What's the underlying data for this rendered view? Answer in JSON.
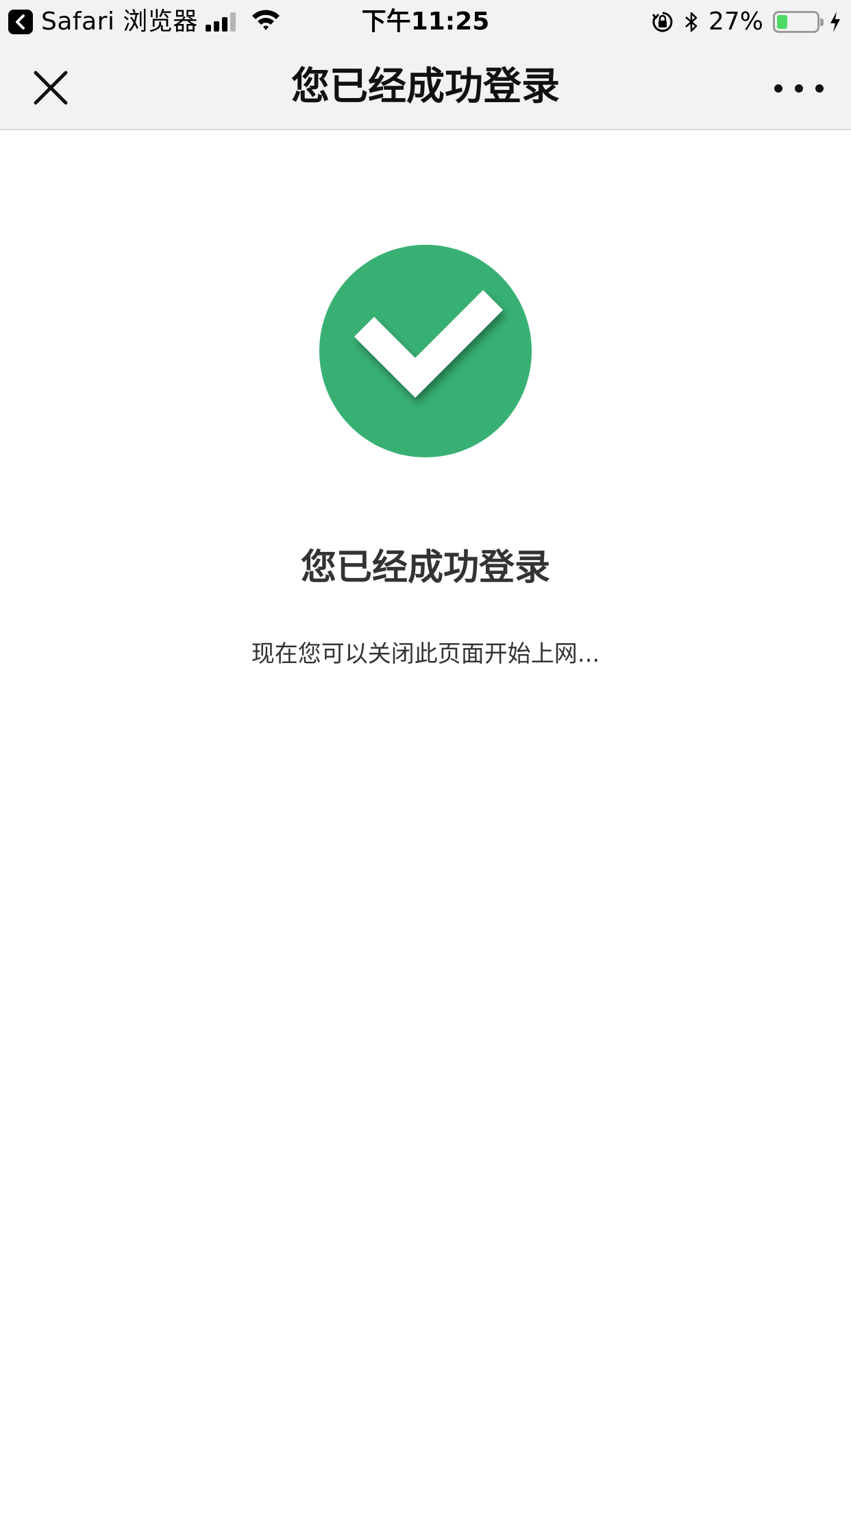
{
  "status_bar": {
    "back_app_label": "Safari 浏览器",
    "time": "下午11:25",
    "battery_percent_text": "27%",
    "battery_level": 0.27,
    "battery_fill_color": "#4cd964",
    "icons": [
      "back-arrow-icon",
      "signal-icon",
      "wifi-icon",
      "orientation-lock-icon",
      "bluetooth-icon",
      "battery-icon",
      "charging-bolt-icon"
    ]
  },
  "nav_bar": {
    "title": "您已经成功登录",
    "close_icon": "close-icon",
    "more_icon": "more-icon"
  },
  "main": {
    "icon": "check-circle-icon",
    "accent_color": "#38b073",
    "title": "您已经成功登录",
    "subtitle": "现在您可以关闭此页面开始上网..."
  }
}
